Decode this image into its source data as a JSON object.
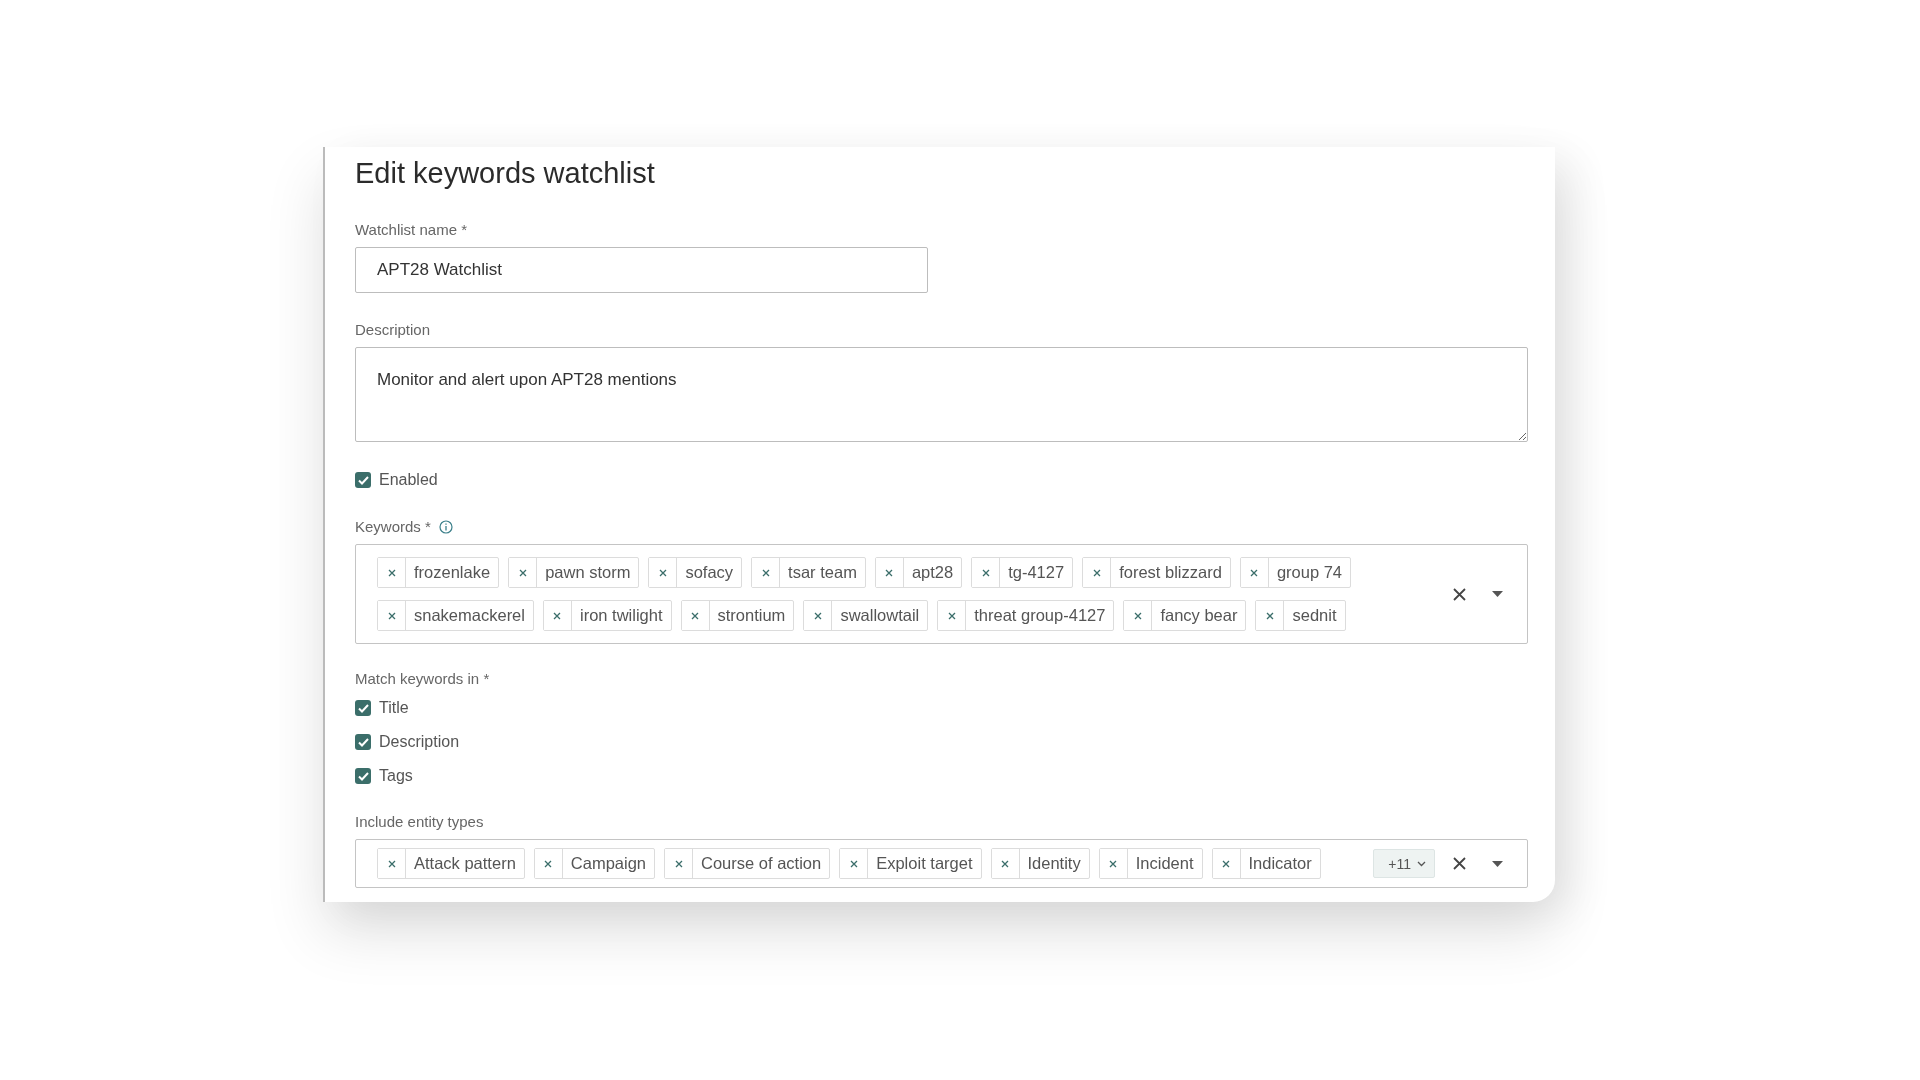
{
  "dialog": {
    "title": "Edit keywords watchlist"
  },
  "name_field": {
    "label": "Watchlist name *",
    "value": "APT28 Watchlist"
  },
  "description_field": {
    "label": "Description",
    "value": "Monitor and alert upon APT28 mentions"
  },
  "enabled": {
    "label": "Enabled",
    "checked": true
  },
  "keywords": {
    "label": "Keywords *",
    "tags": [
      "frozenlake",
      "pawn storm",
      "sofacy",
      "tsar team",
      "apt28",
      "tg-4127",
      "forest blizzard",
      "group 74",
      "snakemackerel",
      "iron twilight",
      "strontium",
      "swallowtail",
      "threat group-4127",
      "fancy bear",
      "sednit"
    ]
  },
  "match_in": {
    "label": "Match keywords in *",
    "options": [
      {
        "label": "Title",
        "checked": true
      },
      {
        "label": "Description",
        "checked": true
      },
      {
        "label": "Tags",
        "checked": true
      }
    ]
  },
  "entity_types": {
    "label": "Include entity types",
    "tags": [
      "Attack pattern",
      "Campaign",
      "Course of action",
      "Exploit target",
      "Identity",
      "Incident",
      "Indicator"
    ],
    "more": "+11"
  }
}
